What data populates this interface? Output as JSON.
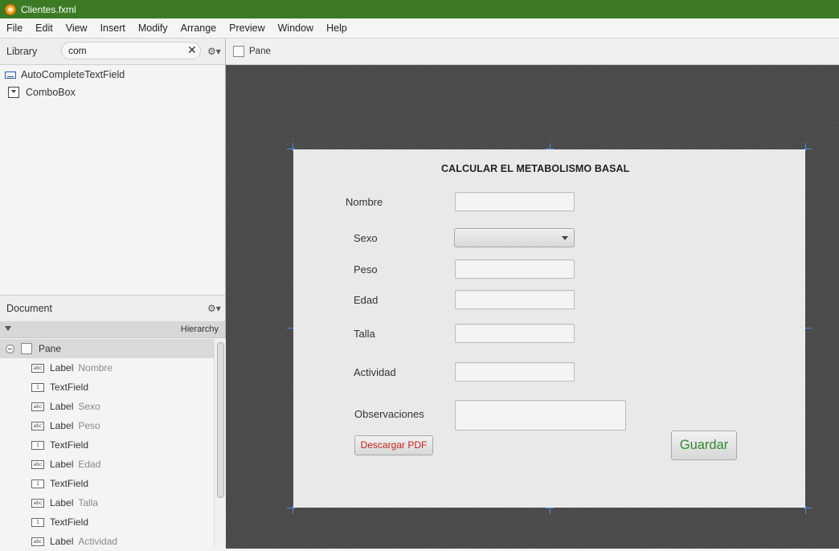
{
  "window": {
    "title": "Clientes.fxml"
  },
  "menu": [
    "File",
    "Edit",
    "View",
    "Insert",
    "Modify",
    "Arrange",
    "Preview",
    "Window",
    "Help"
  ],
  "library": {
    "title": "Library",
    "search_value": "com",
    "items": [
      "AutoCompleteTextField",
      "ComboBox"
    ]
  },
  "document": {
    "title": "Document",
    "hierarchy_label": "Hierarchy",
    "root": "Pane",
    "nodes": [
      {
        "kind": "Label",
        "value": "Nombre",
        "icon": "abc"
      },
      {
        "kind": "TextField",
        "value": "",
        "icon": "I"
      },
      {
        "kind": "Label",
        "value": "Sexo",
        "icon": "abc"
      },
      {
        "kind": "Label",
        "value": "Peso",
        "icon": "abc"
      },
      {
        "kind": "TextField",
        "value": "",
        "icon": "I"
      },
      {
        "kind": "Label",
        "value": "Edad",
        "icon": "abc"
      },
      {
        "kind": "TextField",
        "value": "",
        "icon": "I"
      },
      {
        "kind": "Label",
        "value": "Talla",
        "icon": "abc"
      },
      {
        "kind": "TextField",
        "value": "",
        "icon": "I"
      },
      {
        "kind": "Label",
        "value": "Actividad",
        "icon": "abc"
      }
    ]
  },
  "breadcrumb": {
    "label": "Pane"
  },
  "form": {
    "title": "CALCULAR EL METABOLISMO BASAL",
    "labels": {
      "nombre": "Nombre",
      "sexo": "Sexo",
      "peso": "Peso",
      "edad": "Edad",
      "talla": "Talla",
      "actividad": "Actividad",
      "observaciones": "Observaciones"
    },
    "pdf_button": "Descargar PDF",
    "save_button": "Guardar"
  },
  "colors": {
    "titlebar": "#3c7a25",
    "selection_handles": "#4a8de0",
    "pdf_text": "#c8221c",
    "save_text": "#2e8b2e"
  }
}
